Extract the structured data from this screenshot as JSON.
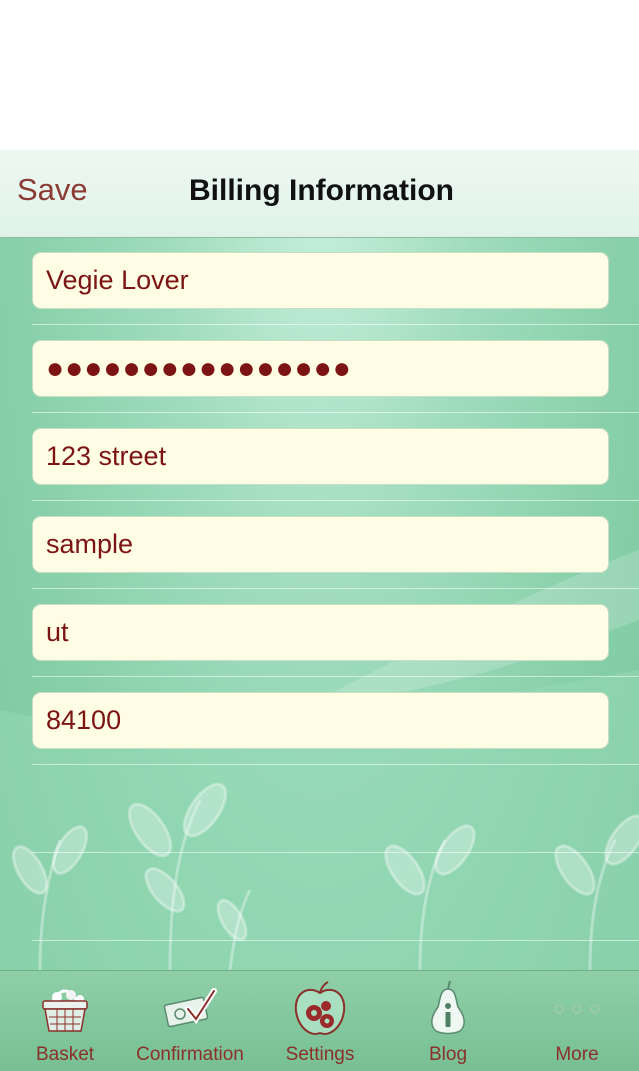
{
  "navbar": {
    "save_label": "Save",
    "title": "Billing Information"
  },
  "fields": {
    "name": "Vegie Lover",
    "password": "●●●●●●●●●●●●●●●●",
    "street": "123 street",
    "city": "sample",
    "state": "ut",
    "zip": "84100"
  },
  "tabs": [
    {
      "label": "Basket",
      "icon": "basket-icon"
    },
    {
      "label": "Confirmation",
      "icon": "ticket-check-icon"
    },
    {
      "label": "Settings",
      "icon": "apple-gears-icon"
    },
    {
      "label": "Blog",
      "icon": "pear-info-icon"
    },
    {
      "label": "More",
      "icon": "more-dots-icon"
    }
  ],
  "colors": {
    "accent": "#8b3b33",
    "field_bg": "#fffde3",
    "field_text": "#7d1414"
  }
}
